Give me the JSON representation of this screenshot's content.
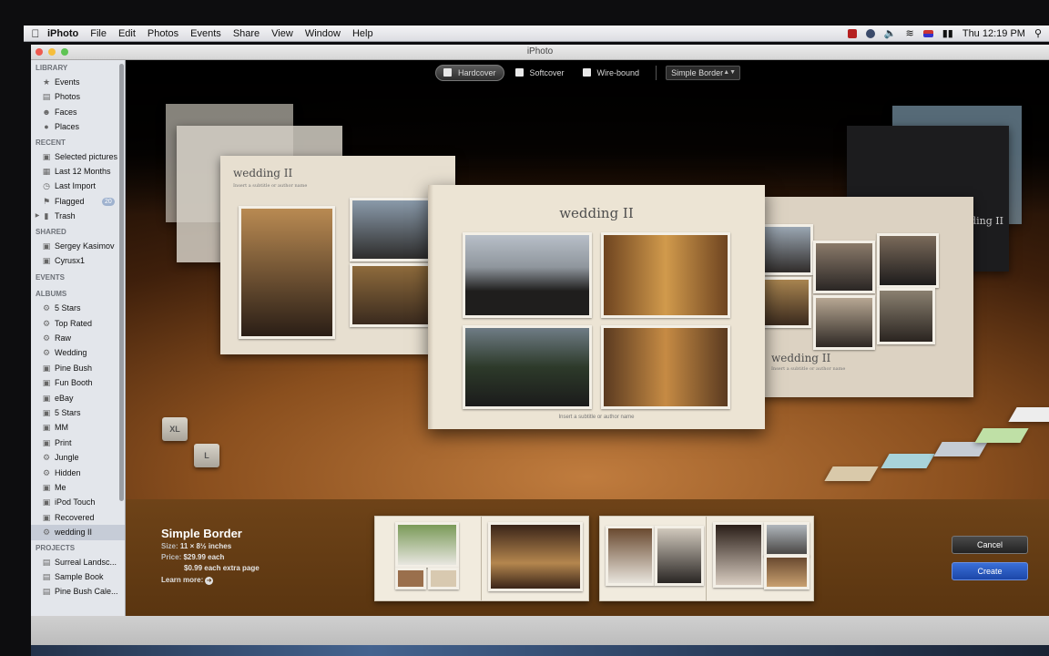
{
  "menubar": {
    "app_name": "iPhoto",
    "menus": [
      "File",
      "Edit",
      "Photos",
      "Events",
      "Share",
      "View",
      "Window",
      "Help"
    ],
    "clock": "Thu 12:19 PM"
  },
  "window": {
    "title": "iPhoto"
  },
  "sidebar": {
    "sections": [
      {
        "title": "LIBRARY",
        "items": [
          {
            "label": "Events",
            "icon": "events-icon"
          },
          {
            "label": "Photos",
            "icon": "photos-icon"
          },
          {
            "label": "Faces",
            "icon": "faces-icon"
          },
          {
            "label": "Places",
            "icon": "places-icon"
          }
        ]
      },
      {
        "title": "RECENT",
        "items": [
          {
            "label": "Selected pictures",
            "icon": "album-icon"
          },
          {
            "label": "Last 12 Months",
            "icon": "calendar-icon"
          },
          {
            "label": "Last Import",
            "icon": "clock-icon"
          },
          {
            "label": "Flagged",
            "icon": "flag-icon",
            "badge": "20"
          },
          {
            "label": "Trash",
            "icon": "trash-icon"
          }
        ]
      },
      {
        "title": "SHARED",
        "items": [
          {
            "label": "Sergey Kasimov",
            "icon": "shared-icon"
          },
          {
            "label": "Cyrusx1",
            "icon": "shared-icon"
          }
        ]
      },
      {
        "title": "EVENTS",
        "items": []
      },
      {
        "title": "ALBUMS",
        "items": [
          {
            "label": "5 Stars",
            "icon": "smart-album-icon"
          },
          {
            "label": "Top Rated",
            "icon": "smart-album-icon"
          },
          {
            "label": "Raw",
            "icon": "smart-album-icon"
          },
          {
            "label": "Wedding",
            "icon": "smart-album-icon"
          },
          {
            "label": "Pine Bush",
            "icon": "album-icon"
          },
          {
            "label": "Fun Booth",
            "icon": "album-icon"
          },
          {
            "label": "eBay",
            "icon": "album-icon"
          },
          {
            "label": "5 Stars",
            "icon": "album-icon"
          },
          {
            "label": "MM",
            "icon": "album-icon"
          },
          {
            "label": "Print",
            "icon": "album-icon"
          },
          {
            "label": "Jungle",
            "icon": "smart-album-icon"
          },
          {
            "label": "Hidden",
            "icon": "smart-album-icon"
          },
          {
            "label": "Me",
            "icon": "album-icon"
          },
          {
            "label": "iPod Touch",
            "icon": "album-icon"
          },
          {
            "label": "Recovered",
            "icon": "album-icon"
          },
          {
            "label": "wedding II",
            "icon": "smart-album-icon",
            "selected": true
          }
        ]
      },
      {
        "title": "PROJECTS",
        "items": [
          {
            "label": "Surreal Landsc...",
            "icon": "project-icon"
          },
          {
            "label": "Sample Book",
            "icon": "project-icon"
          },
          {
            "label": "Pine Bush Cale...",
            "icon": "project-icon"
          }
        ]
      }
    ]
  },
  "toolbar": {
    "formats": [
      "Hardcover",
      "Softcover",
      "Wire-bound"
    ],
    "selected_format": "Hardcover",
    "theme_select": "Simple Border"
  },
  "books": {
    "center_title": "wedding II",
    "center_subtitle": "Insert a subtitle or author name",
    "left_title": "wedding II",
    "left_subtitle": "Insert a subtitle or author name",
    "right_title": "wedding II",
    "right_subtitle": "Insert a subtitle or author name",
    "back_right_title": "wedding II"
  },
  "sizes": [
    "XL",
    "L"
  ],
  "swatch_colors": [
    "#d9c9aa",
    "#a8d3da",
    "#c5ccd4",
    "#bfe0a6",
    "#ededed"
  ],
  "theme": {
    "name": "Simple Border",
    "size_label": "Size:",
    "size_value": "11 × 8½ inches",
    "price_label": "Price:",
    "price_value": "$29.99 each",
    "extra_page": "$0.99 each extra page",
    "learn_more": "Learn more:"
  },
  "buttons": {
    "cancel": "Cancel",
    "create": "Create"
  }
}
